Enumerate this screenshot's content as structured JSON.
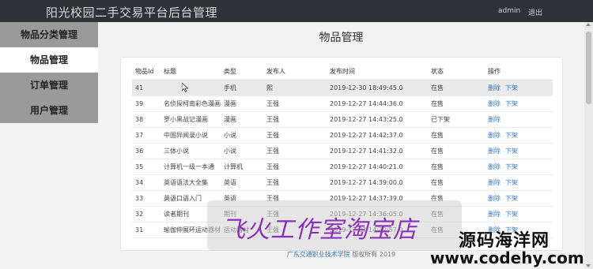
{
  "header": {
    "app_title": "阳光校园二手交易平台后台管理",
    "user": "admin",
    "logout": "退出"
  },
  "sidebar": {
    "items": [
      {
        "label": "物品分类管理"
      },
      {
        "label": "物品管理"
      },
      {
        "label": "订单管理"
      },
      {
        "label": "用户管理"
      }
    ],
    "active_index": 1
  },
  "main": {
    "title": "物品管理"
  },
  "table": {
    "columns": [
      "物品Id",
      "标题",
      "类型",
      "发布人",
      "发布时间",
      "状态",
      "操作"
    ],
    "rows": [
      {
        "id": "41",
        "title": "",
        "type": "手机",
        "user": "熙",
        "time": "2019-12-30 18:49:45.0",
        "status": "在售",
        "ops": [
          "删除",
          "下架"
        ]
      },
      {
        "id": "39",
        "title": "名侦探柯南彩色漫画",
        "type": "漫画",
        "user": "王强",
        "time": "2019-12-27 14:44:36.0",
        "status": "在售",
        "ops": [
          "删除",
          "下架"
        ]
      },
      {
        "id": "38",
        "title": "罗小黑战记漫画",
        "type": "漫画",
        "user": "王强",
        "time": "2019-12-27 14:43:25.0",
        "status": "已下架",
        "ops": [
          "删除"
        ]
      },
      {
        "id": "37",
        "title": "中国异闻录小说",
        "type": "小说",
        "user": "王强",
        "time": "2019-12-27 14:42:37.0",
        "status": "在售",
        "ops": [
          "删除",
          "下架"
        ]
      },
      {
        "id": "36",
        "title": "三体小说",
        "type": "小说",
        "user": "王强",
        "time": "2019-12-27 14:41:32.0",
        "status": "在售",
        "ops": [
          "删除",
          "下架"
        ]
      },
      {
        "id": "35",
        "title": "计算机一级一本通",
        "type": "计算机",
        "user": "王强",
        "time": "2019-12-27 14:40:21.0",
        "status": "在售",
        "ops": [
          "删除",
          "下架"
        ]
      },
      {
        "id": "34",
        "title": "英语语法大全集",
        "type": "英语",
        "user": "王强",
        "time": "2019-12-27 14:39:00.0",
        "status": "在售",
        "ops": [
          "删除",
          "下架"
        ]
      },
      {
        "id": "33",
        "title": "英语口语入门",
        "type": "英语",
        "user": "王强",
        "time": "2019-12-27 14:37:39.0",
        "status": "在售",
        "ops": [
          "删除",
          "下架"
        ]
      },
      {
        "id": "32",
        "title": "读者期刊",
        "type": "期刊",
        "user": "王强",
        "time": "2019-12-27 14:36:05.0",
        "status": "在售",
        "ops": [
          "删除",
          "下架"
        ]
      },
      {
        "id": "31",
        "title": "瑜伽伸展环运动器材",
        "type": "运动器材",
        "user": "王强",
        "time": "2019-12-27 14:32:57.0",
        "status": "在售",
        "ops": [
          "删除",
          "下架"
        ]
      }
    ],
    "highlight_row": 0
  },
  "footer": {
    "link": "广东交通职业技术学院",
    "text": "版权所有",
    "year": "2019"
  },
  "watermark": {
    "studio": "飞火工作室淘宝店",
    "brand": "源码海洋网",
    "url": "www.codehy.com"
  },
  "colors": {
    "topbar": "#2f3338",
    "sidebar": "#9a9a9a",
    "link": "#3c79c0",
    "watermark_purple": "#8a2fb8"
  }
}
